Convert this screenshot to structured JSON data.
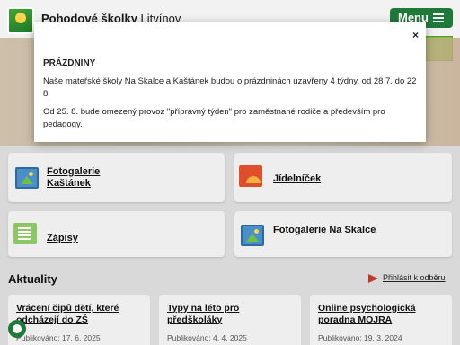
{
  "header": {
    "site_name_bold": "Pohodové školky",
    "site_name_rest": " Litvínov",
    "menu_label": "Menu"
  },
  "modal": {
    "close_label": "×",
    "heading": "PRÁZDNINY",
    "paragraph1": "Naše mateřské školy Na Skalce a Kaštánek budou o prázdninách uzavřeny 4 týdny, od 28 7. do 22 8.",
    "paragraph2": "Od 25. 8. bude omezený provoz \"přípravný týden\" pro zaměstnané rodiče a především pro pedagogy."
  },
  "tiles": [
    {
      "label": "Fotogalerie Kaštánek",
      "icon": "photo-gallery-icon"
    },
    {
      "label": "Jídelníček",
      "icon": "food-menu-icon"
    },
    {
      "label": "Zápisy",
      "icon": "document-icon"
    },
    {
      "label": "Fotogalerie Na Skalce",
      "icon": "photo-gallery-icon"
    }
  ],
  "news": {
    "heading": "Aktuality",
    "subscribe_label": "Přihlásit k odběru",
    "items": [
      {
        "title": "Vrácení čipů dětí, které odcházejí do ZŠ",
        "date": "Publikováno: 17. 6. 2025"
      },
      {
        "title": "Typy na léto pro předškoláky",
        "date": "Publikováno: 4. 4. 2025"
      },
      {
        "title": "Online psychologická poradna MOJRA",
        "date": "Publikováno: 19. 3. 2024"
      }
    ]
  },
  "colors": {
    "accent": "#1f7a3a",
    "subscribe_icon": "#c0392b"
  }
}
